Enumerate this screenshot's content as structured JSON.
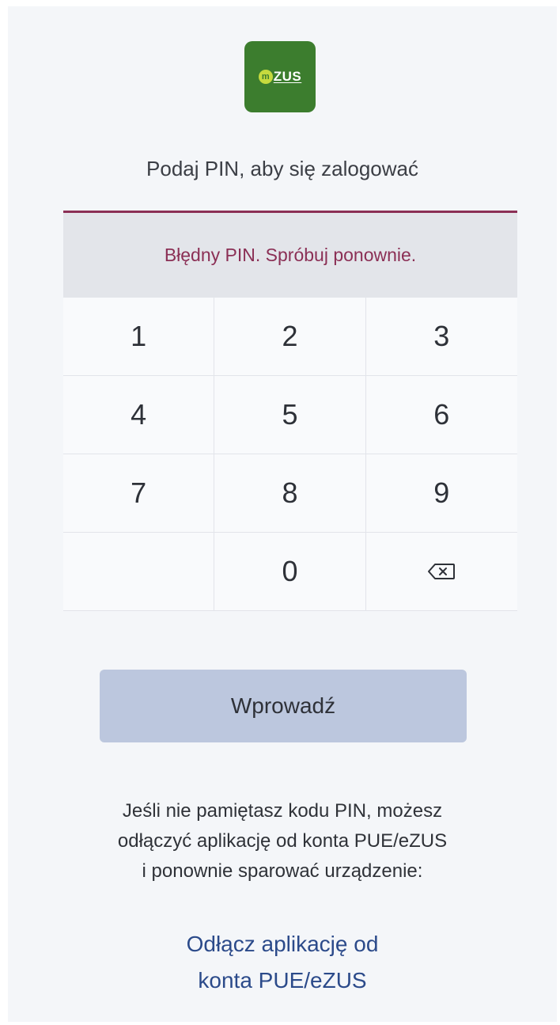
{
  "app": {
    "logo_text": "ZUS",
    "logo_badge": "m"
  },
  "login": {
    "prompt": "Podaj PIN, aby się zalogować",
    "error_message": "Błędny PIN. Spróbuj ponownie."
  },
  "keypad": {
    "keys": [
      "1",
      "2",
      "3",
      "4",
      "5",
      "6",
      "7",
      "8",
      "9",
      "",
      "0",
      "backspace"
    ],
    "backspace_icon": "backspace-icon"
  },
  "actions": {
    "enter_label": "Wprowadź"
  },
  "help": {
    "text": "Jeśli nie pamiętasz kodu PIN, możesz\nodłączyć aplikację od konta PUE/eZUS\ni ponownie sparować urządzenie:",
    "disconnect_link": "Odłącz aplikację od\nkonta PUE/eZUS"
  },
  "colors": {
    "logo_bg": "#3c7d2e",
    "logo_badge": "#c6da3e",
    "error": "#8b2f55",
    "button_bg": "#bcc7de",
    "link": "#2b4a8a"
  }
}
